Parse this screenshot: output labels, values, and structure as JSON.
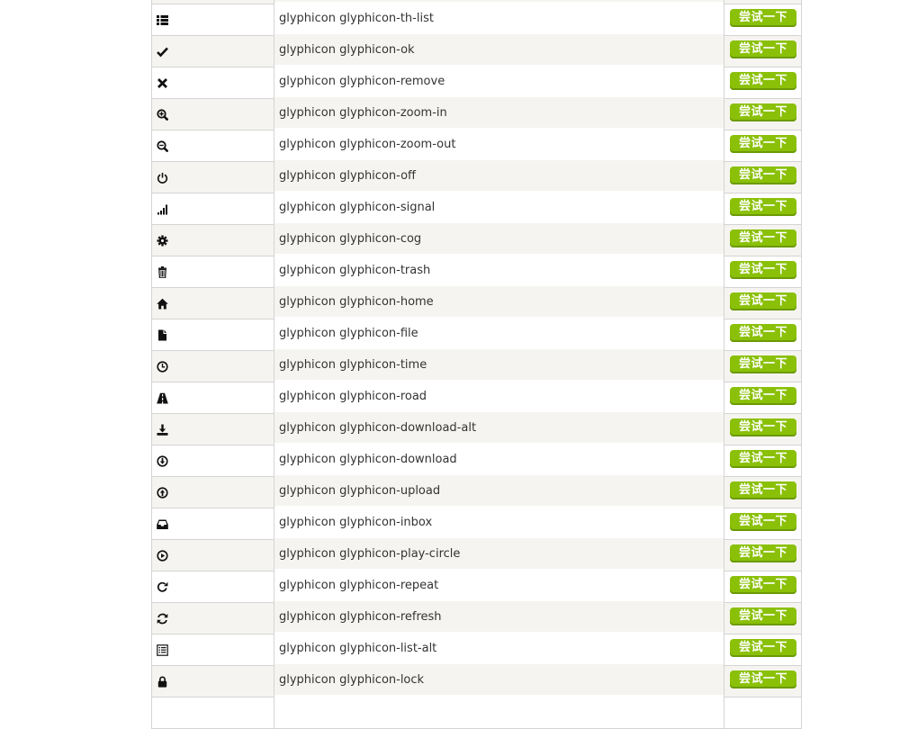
{
  "button_label": "尝试一下",
  "colors": {
    "button": "#8ac007",
    "row_alt": "#f6f4f0",
    "border": "#d4d4d4"
  },
  "rows": [
    {
      "icon": "partial-row-icon",
      "class": ""
    },
    {
      "icon": "th-list-icon",
      "class": "glyphicon glyphicon-th-list"
    },
    {
      "icon": "ok-icon",
      "class": "glyphicon glyphicon-ok"
    },
    {
      "icon": "remove-icon",
      "class": "glyphicon glyphicon-remove"
    },
    {
      "icon": "zoom-in-icon",
      "class": "glyphicon glyphicon-zoom-in"
    },
    {
      "icon": "zoom-out-icon",
      "class": "glyphicon glyphicon-zoom-out"
    },
    {
      "icon": "off-icon",
      "class": "glyphicon glyphicon-off"
    },
    {
      "icon": "signal-icon",
      "class": "glyphicon glyphicon-signal"
    },
    {
      "icon": "cog-icon",
      "class": "glyphicon glyphicon-cog"
    },
    {
      "icon": "trash-icon",
      "class": "glyphicon glyphicon-trash"
    },
    {
      "icon": "home-icon",
      "class": "glyphicon glyphicon-home"
    },
    {
      "icon": "file-icon",
      "class": "glyphicon glyphicon-file"
    },
    {
      "icon": "time-icon",
      "class": "glyphicon glyphicon-time"
    },
    {
      "icon": "road-icon",
      "class": "glyphicon glyphicon-road"
    },
    {
      "icon": "download-alt-icon",
      "class": "glyphicon glyphicon-download-alt"
    },
    {
      "icon": "download-icon",
      "class": "glyphicon glyphicon-download"
    },
    {
      "icon": "upload-icon",
      "class": "glyphicon glyphicon-upload"
    },
    {
      "icon": "inbox-icon",
      "class": "glyphicon glyphicon-inbox"
    },
    {
      "icon": "play-circle-icon",
      "class": "glyphicon glyphicon-play-circle"
    },
    {
      "icon": "repeat-icon",
      "class": "glyphicon glyphicon-repeat"
    },
    {
      "icon": "refresh-icon",
      "class": "glyphicon glyphicon-refresh"
    },
    {
      "icon": "list-alt-icon",
      "class": "glyphicon glyphicon-list-alt"
    },
    {
      "icon": "lock-icon",
      "class": "glyphicon glyphicon-lock"
    },
    {
      "icon": "partial-row-icon",
      "class": ""
    }
  ]
}
